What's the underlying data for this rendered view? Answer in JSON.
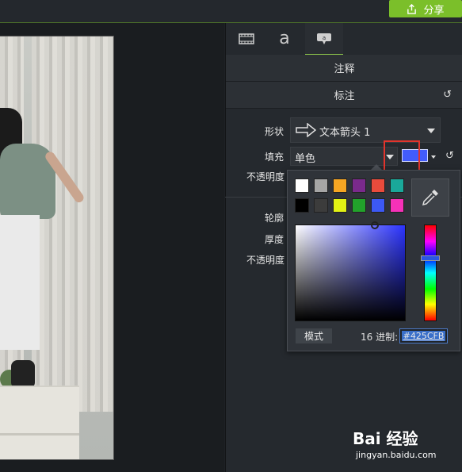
{
  "topbar": {
    "share_label": "分享"
  },
  "tabs": [
    {
      "icon": "film-icon",
      "active": false
    },
    {
      "icon": "text-a-icon",
      "label": "a",
      "active": false
    },
    {
      "icon": "callout-icon",
      "active": true
    }
  ],
  "sections": {
    "annotations": "注释",
    "callout": "标注"
  },
  "properties": {
    "shape_label": "形状",
    "shape_value": "文本箭头 1",
    "fill_label": "填充",
    "fill_value": "单色",
    "opacity_label": "不透明度",
    "outline_label": "轮廓",
    "thickness_label": "厚度",
    "outline_opacity_label": "不透明度"
  },
  "color_picker": {
    "swatches_row1": [
      "#ffffff",
      "#a6a6a6",
      "#f5a623",
      "#7a2a8c",
      "#ea4b3c",
      "#1aa89a"
    ],
    "swatches_row2": [
      "#000000",
      "#3c3c3c",
      "#e2f214",
      "#22a22b",
      "#3c59f5",
      "#f531b8"
    ],
    "mode_label": "模式",
    "hex_label": "16 进制:",
    "hex_value": "#425CFB",
    "current_color": "#425CFB"
  },
  "watermark": {
    "main": "Bai 经验",
    "sub": "jingyan.baidu.com"
  }
}
